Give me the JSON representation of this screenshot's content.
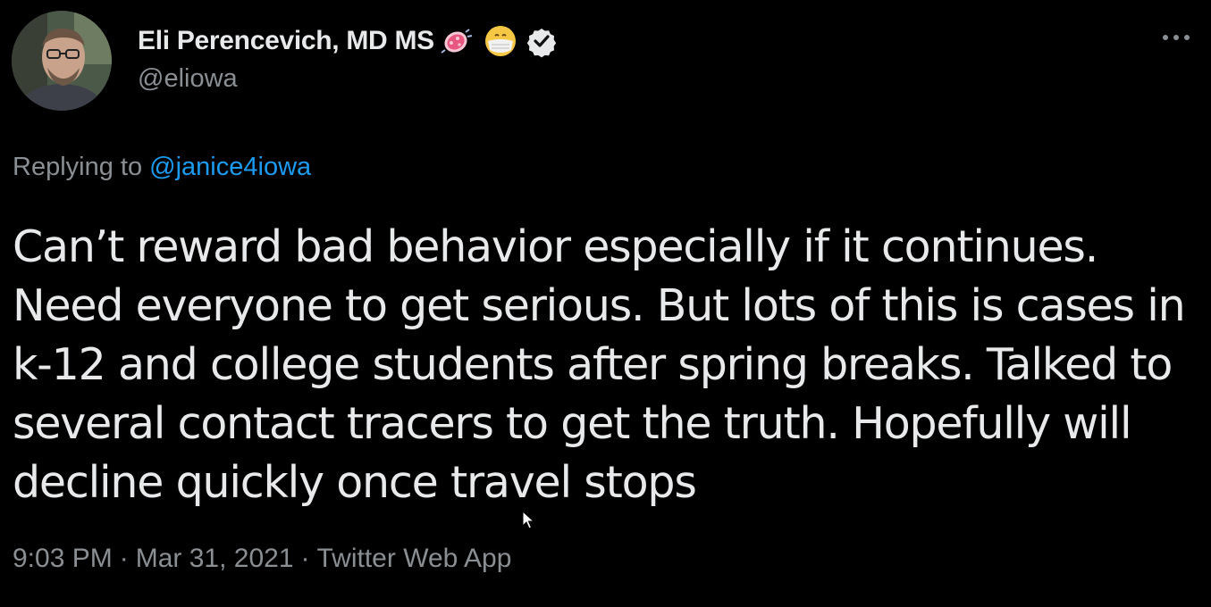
{
  "tweet": {
    "display_name": "Eli Perencevich, MD MS",
    "handle": "@eliowa",
    "replying_prefix": "Replying to",
    "replying_to": "@janice4iowa",
    "text": "Can’t reward bad behavior especially if it continues. Need everyone to get serious. But lots of this is cases in k-12 and college students after spring breaks. Talked to several contact tracers to get the truth. Hopefully will decline quickly once travel stops",
    "time": "9:03 PM",
    "date": "Mar 31, 2021",
    "source": "Twitter Web App",
    "separator": "·"
  },
  "icons": {
    "avatar": "profile-photo",
    "emoji_1": "bacteria-icon",
    "emoji_2": "face-with-mask-icon",
    "verified": "verified-badge-icon",
    "more": "more-options-icon",
    "cursor": "mouse-pointer-icon"
  },
  "colors": {
    "background": "#000000",
    "text_primary": "#e7e9ea",
    "text_secondary": "#8a8f94",
    "link": "#1d9bf0"
  }
}
